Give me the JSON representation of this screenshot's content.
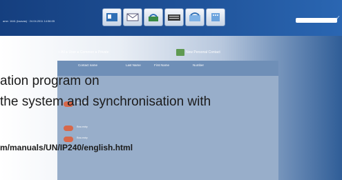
{
  "status_text": "ame: 1641 (ksavas) · 24.04.2011 14:56:05",
  "filter_label": "○ All ● User ● Common ● Private",
  "new_contact_label": "New Personal Contact",
  "columns": [
    "Contact name",
    "Last Name",
    "First Name",
    "Number"
  ],
  "overlay": {
    "line1": "ation program on",
    "line2": "the system and synchronisation with",
    "url": "m/manuals/UN/IP240/english.html"
  },
  "rows": [
    "Row entry",
    "Row entry",
    "Row entry"
  ],
  "toolbar": [
    "contacts-icon",
    "mail-icon",
    "call-icon",
    "keyboard-icon",
    "phone-icon",
    "dialpad-icon"
  ],
  "colors": {
    "topbar": "#1d4e93",
    "panel": "#98aeca",
    "accent": "#d7684a"
  }
}
